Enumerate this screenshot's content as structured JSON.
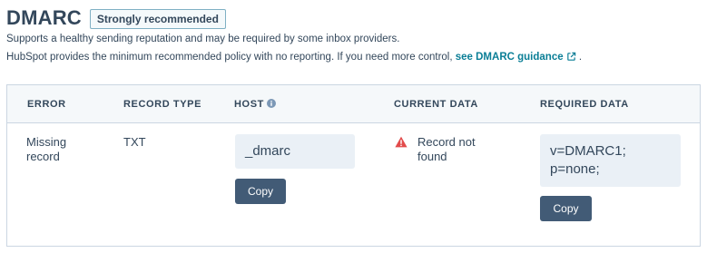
{
  "header": {
    "title": "DMARC",
    "badge": "Strongly recommended"
  },
  "description": {
    "line1": "Supports a healthy sending reputation and may be required by some inbox providers.",
    "line2_prefix": "HubSpot provides the minimum recommended policy with no reporting. If you need more control,",
    "link_text": "see DMARC guidance",
    "line2_suffix": "."
  },
  "table": {
    "headers": {
      "error": "ERROR",
      "record_type": "RECORD TYPE",
      "host": "HOST",
      "current_data": "CURRENT DATA",
      "required_data": "REQUIRED DATA"
    },
    "row": {
      "error_line1": "Missing",
      "error_line2": "record",
      "record_type": "TXT",
      "host_value": "_dmarc",
      "host_copy_label": "Copy",
      "current_line1": "Record not",
      "current_line2": "found",
      "required_line1": "v=DMARC1;",
      "required_line2": "p=none;",
      "required_copy_label": "Copy"
    }
  },
  "colors": {
    "link": "#0a7e96",
    "button": "#425b76",
    "warning": "#e24b4b",
    "badge_border": "#7fb0c4"
  },
  "icons": {
    "external_link": "external-link-icon",
    "info": "info-icon",
    "warning": "warning-icon"
  }
}
